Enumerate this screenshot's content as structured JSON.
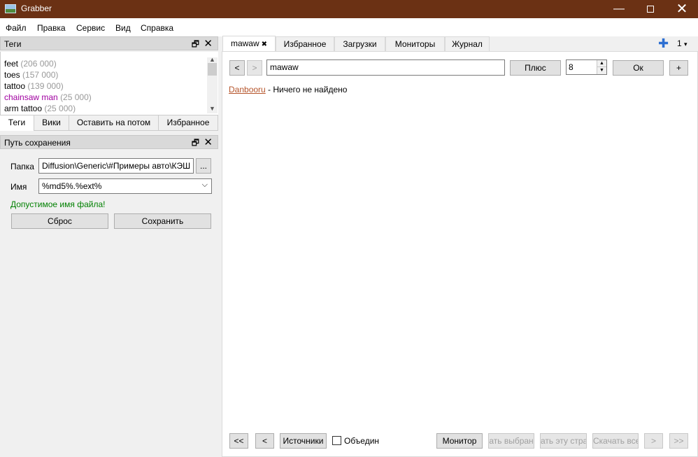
{
  "window": {
    "title": "Grabber",
    "minimize": "—",
    "close": "✕"
  },
  "menu": [
    "Файл",
    "Правка",
    "Сервис",
    "Вид",
    "Справка"
  ],
  "tags_panel": {
    "title": "Теги",
    "items": [
      {
        "name": "feet",
        "count": "(206 000)"
      },
      {
        "name": "toes",
        "count": "(157 000)"
      },
      {
        "name": "tattoo",
        "count": "(139 000)"
      },
      {
        "name": "chainsaw man",
        "count": "(25 000)"
      },
      {
        "name": "arm tattoo",
        "count": "(25 000)"
      }
    ],
    "tabs": [
      "Теги",
      "Вики",
      "Оставить на потом",
      "Избранное"
    ]
  },
  "save_panel": {
    "title": "Путь сохранения",
    "folder_label": "Папка",
    "folder_value": "Diffusion\\Generic\\#Примеры авто\\КЭШ",
    "browse": "...",
    "name_label": "Имя",
    "name_value": "%md5%.%ext%",
    "valid_msg": "Допустимое имя файла!",
    "reset": "Сброс",
    "save": "Сохранить"
  },
  "main_tabs": [
    "mawaw",
    "Избранное",
    "Загрузки",
    "Мониторы",
    "Журнал"
  ],
  "tab_close_glyph": "✖",
  "page_counter": "1",
  "dropdown_glyph": "▾",
  "search": {
    "prev": "<",
    "next": ">",
    "query": "mawaw",
    "plus_btn": "Плюс",
    "per_page": "8",
    "ok": "Ок",
    "add": "+"
  },
  "result": {
    "source": "Danbooru",
    "message": " - Ничего не найдено"
  },
  "bottom": {
    "first": "<<",
    "prev": "<",
    "sources": "Источники",
    "merge_label": "Объедин",
    "monitor": "Монитор",
    "dl_selected": "ать выбран",
    "dl_page": "ать эту стра",
    "dl_all": "Скачать все",
    "next": ">",
    "last": ">>"
  },
  "icons": {
    "app": "picture-icon",
    "float": "float-icon",
    "close": "close-icon",
    "add_tab": "plus-icon"
  },
  "colors": {
    "titlebar": "#6b3114",
    "link": "#b5542a",
    "valid": "#008000",
    "tag_special": "#a000a0",
    "tag_count": "#999999"
  }
}
